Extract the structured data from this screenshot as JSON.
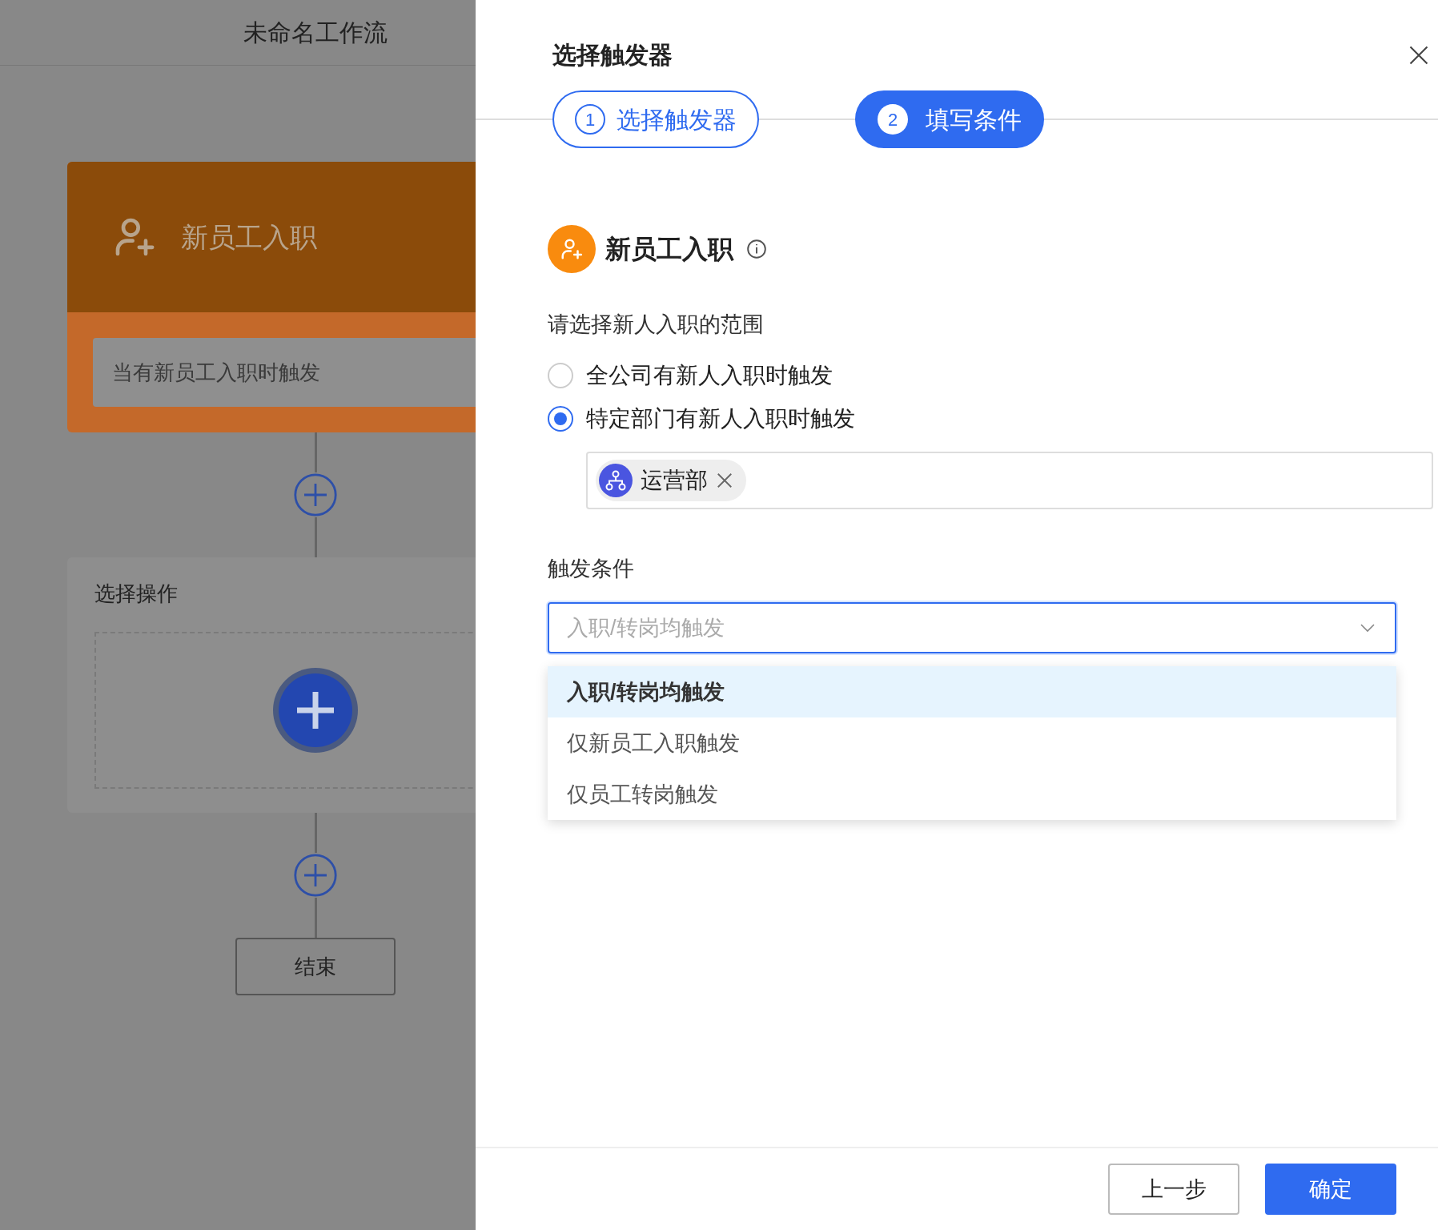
{
  "canvas": {
    "title": "未命名工作流",
    "trigger_card": {
      "title": "新员工入职",
      "description": "当有新员工入职时触发"
    },
    "action_card": {
      "title": "选择操作"
    },
    "end_node": "结束"
  },
  "drawer": {
    "title": "选择触发器",
    "steps": [
      {
        "number": "1",
        "label": "选择触发器",
        "selected": false
      },
      {
        "number": "2",
        "label": "填写条件",
        "selected": true
      }
    ],
    "trigger": {
      "name": "新员工入职"
    },
    "scope": {
      "label": "请选择新人入职的范围",
      "options": [
        {
          "label": "全公司有新人入职时触发",
          "selected": false
        },
        {
          "label": "特定部门有新人入职时触发",
          "selected": true
        }
      ]
    },
    "departments": [
      {
        "name": "运营部"
      }
    ],
    "condition": {
      "label": "触发条件",
      "placeholder": "入职/转岗均触发",
      "expanded": true,
      "options": [
        {
          "label": "入职/转岗均触发",
          "selected": true
        },
        {
          "label": "仅新员工入职触发",
          "selected": false
        },
        {
          "label": "仅员工转岗触发",
          "selected": false
        }
      ]
    },
    "buttons": [
      {
        "label": "上一步",
        "kind": "secondary"
      },
      {
        "label": "确定",
        "kind": "primary"
      }
    ]
  }
}
